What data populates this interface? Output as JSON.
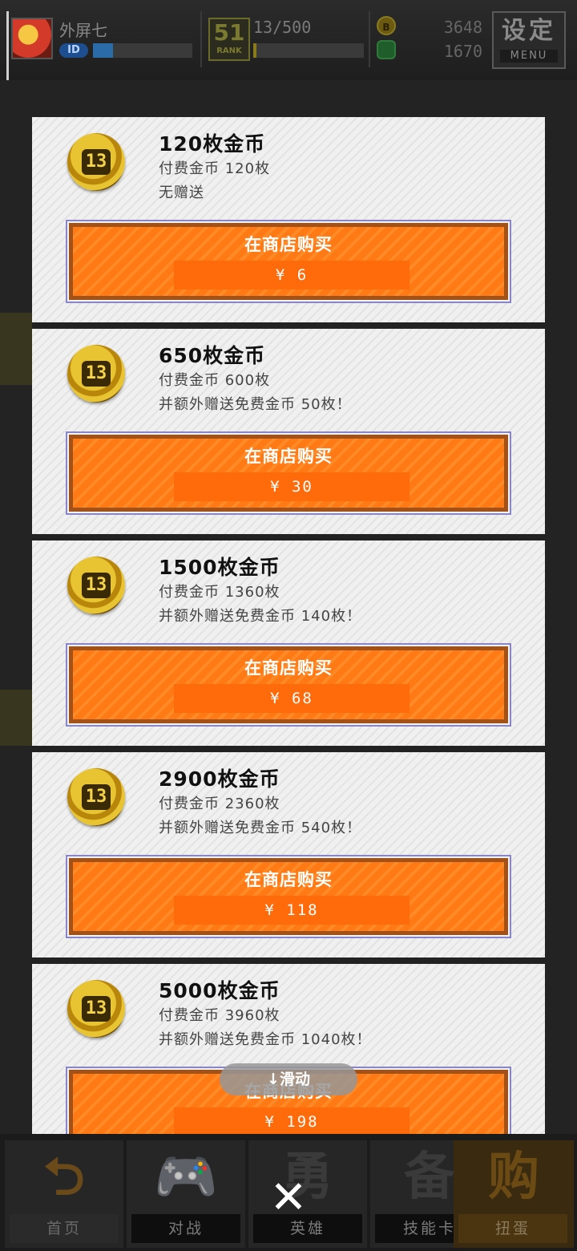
{
  "topbar": {
    "player_name": "外屏七",
    "id_badge": "ID",
    "exp_fill": 0.2,
    "rank_number": "51",
    "rank_label": "RANK",
    "rank_progress": "13/500",
    "rank_fill": 0.03,
    "gold_icon": "B",
    "gold_amount": "3648",
    "green_amount": "1670",
    "menu_title": "设定",
    "menu_label": "MENU"
  },
  "coin_packs": [
    {
      "title": "120枚金币",
      "paid": "付费金币 120枚",
      "bonus": "无赠送",
      "buy_label": "在商店购买",
      "price": "¥  6"
    },
    {
      "title": "650枚金币",
      "paid": "付费金币 600枚",
      "bonus": "并额外赠送免费金币 50枚！",
      "buy_label": "在商店购买",
      "price": "¥  30"
    },
    {
      "title": "1500枚金币",
      "paid": "付费金币 1360枚",
      "bonus": "并额外赠送免费金币 140枚！",
      "buy_label": "在商店购买",
      "price": "¥  68"
    },
    {
      "title": "2900枚金币",
      "paid": "付费金币 2360枚",
      "bonus": "并额外赠送免费金币 540枚！",
      "buy_label": "在商店购买",
      "price": "¥  118"
    },
    {
      "title": "5000枚金币",
      "paid": "付费金币 3960枚",
      "bonus": "并额外赠送免费金币 1040枚！",
      "buy_label": "在商店购买",
      "price": "¥  198"
    }
  ],
  "scroll_hint": "↓滑动",
  "bottom_nav": {
    "home": "首页",
    "battle": "对战",
    "heroes": "英雄",
    "heroes_glyph": "勇",
    "skills": "技能卡",
    "skills_glyph": "备",
    "gacha": "扭蛋",
    "gacha_glyph": "购"
  },
  "close": "✕",
  "colors": {
    "buy_orange": "#ff7a14",
    "buy_border": "#a0521a",
    "price_orange": "#ff6a0a",
    "background": "#232323"
  }
}
